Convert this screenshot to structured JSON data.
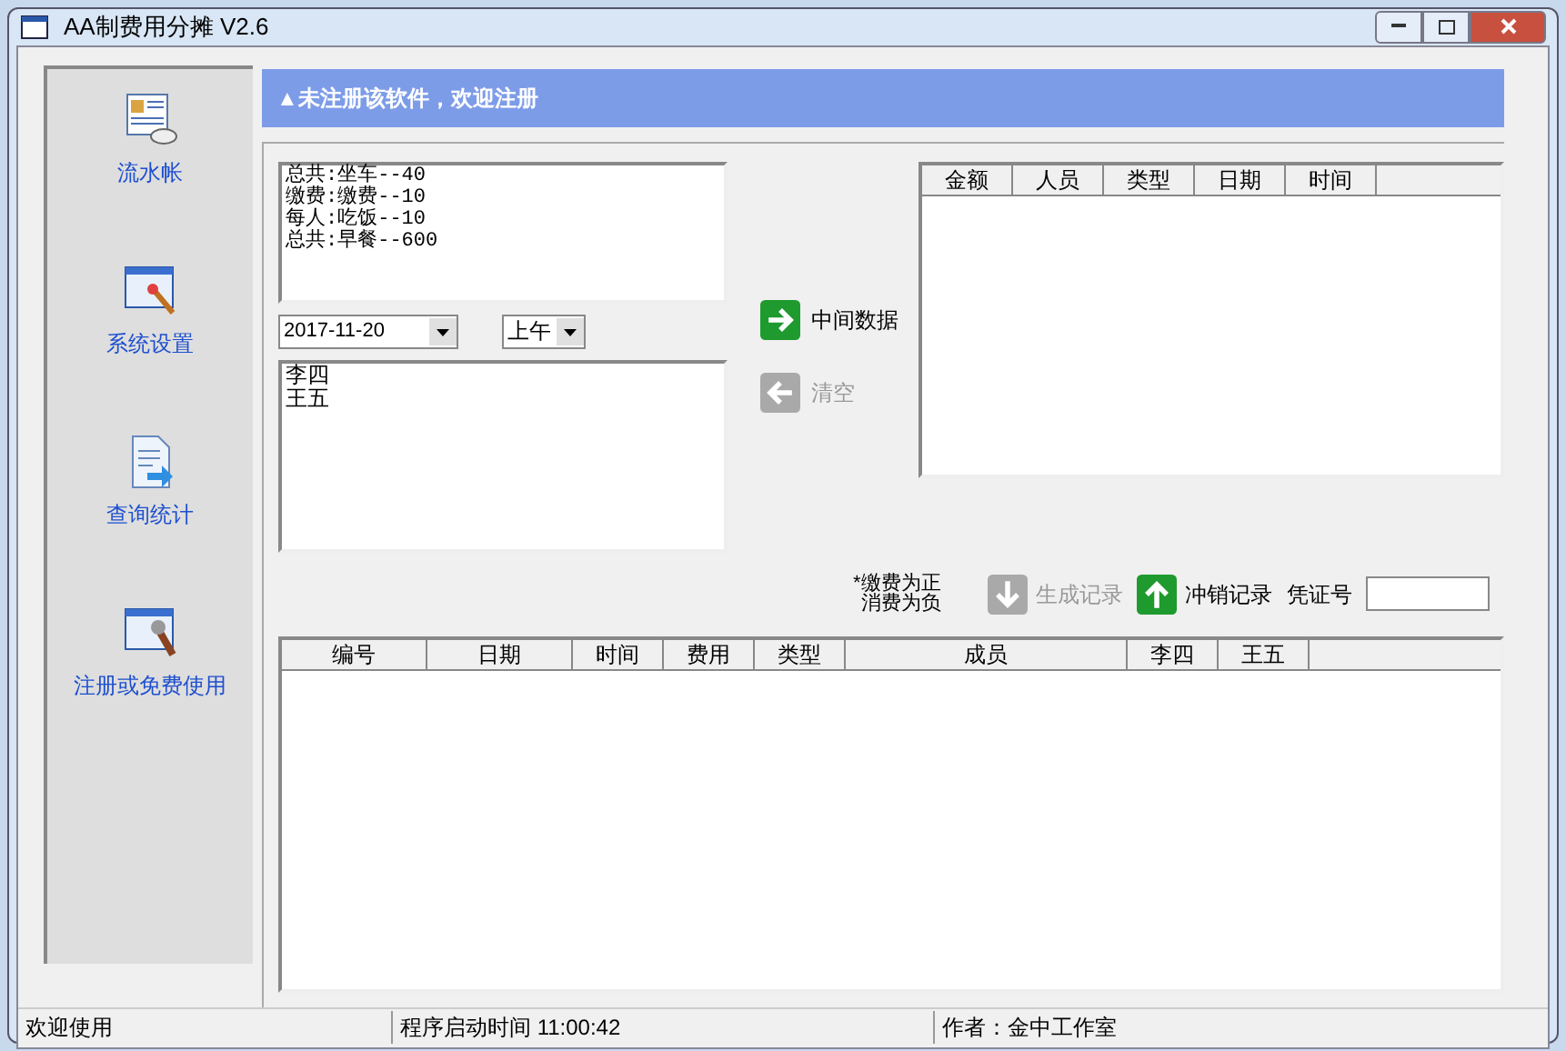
{
  "window": {
    "title": "AA制费用分摊 V2.6"
  },
  "sidebar": {
    "items": [
      {
        "label": "流水帐",
        "kind": "ledger"
      },
      {
        "label": "系统设置",
        "kind": "settings"
      },
      {
        "label": "查询统计",
        "kind": "export"
      },
      {
        "label": "注册或免费使用",
        "kind": "register"
      }
    ]
  },
  "banner": "▲未注册该软件，欢迎注册",
  "memo": [
    "总共:坐车--40",
    "缴费:缴费--10",
    "每人:吃饭--10",
    "总共:早餐--600"
  ],
  "date_field": {
    "value": "2017-11-20"
  },
  "period_field": {
    "value": "上午"
  },
  "members": [
    "李四",
    "王五"
  ],
  "middle_buttons": [
    {
      "label": "中间数据",
      "kind": "right",
      "disabled": false
    },
    {
      "label": "清空",
      "kind": "left",
      "disabled": true
    }
  ],
  "records_table": {
    "columns": [
      "金额",
      "人员",
      "类型",
      "日期",
      "时间"
    ]
  },
  "note": [
    "*缴费为正",
    "消费为负"
  ],
  "action_buttons": [
    {
      "label": "生成记录",
      "kind": "down",
      "disabled": true
    },
    {
      "label": "冲销记录",
      "kind": "up",
      "disabled": false
    }
  ],
  "voucher_field": {
    "label": "凭证号"
  },
  "main_table": {
    "columns": [
      "编号",
      "日期",
      "时间",
      "费用",
      "类型",
      "成员",
      "李四",
      "王五"
    ]
  },
  "status_bar": [
    "欢迎使用",
    "程序启动时间 11:00:42",
    "作者：金中工作室"
  ]
}
